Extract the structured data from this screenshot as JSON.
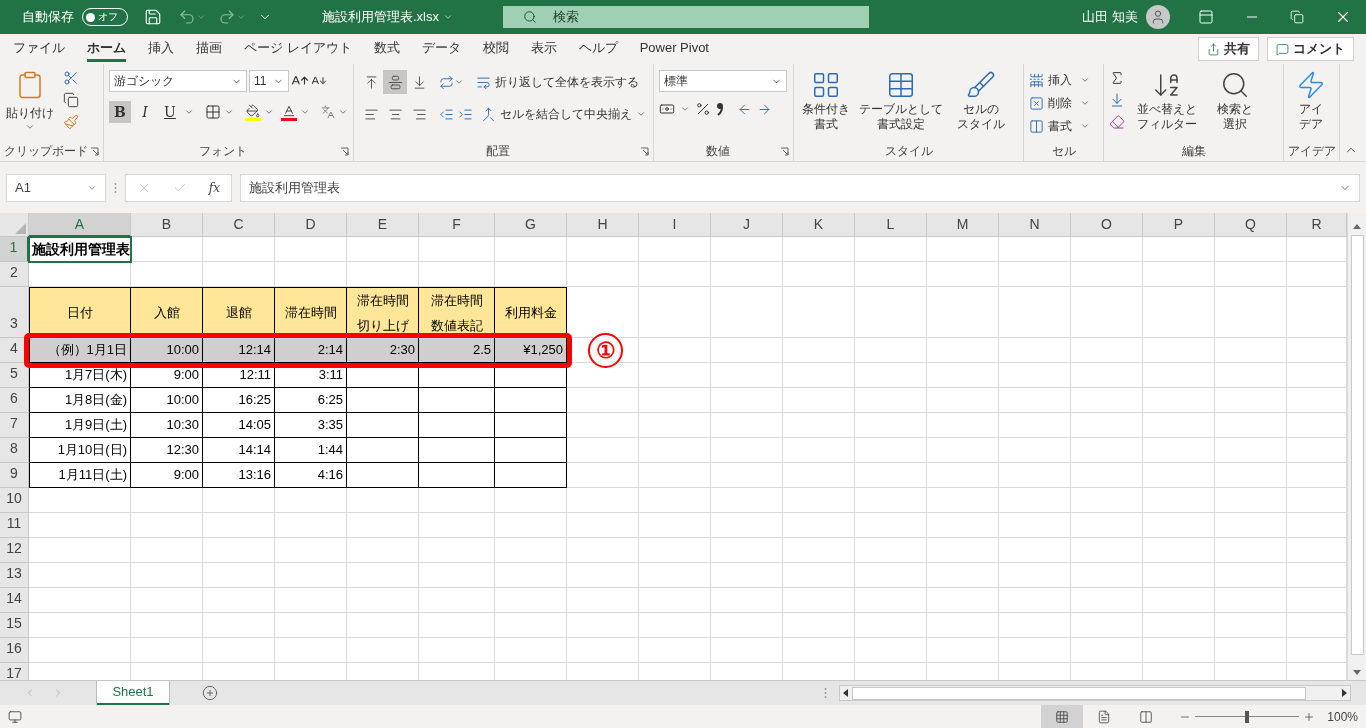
{
  "title_bar": {
    "autosave_label": "自動保存",
    "autosave": {
      "on": false,
      "label": "オフ"
    },
    "filename": "施設利用管理表.xlsx",
    "search_placeholder": "検索",
    "user_name": "山田 知美"
  },
  "menu_tabs": [
    {
      "label": "ファイル",
      "selected": false
    },
    {
      "label": "ホーム",
      "selected": true
    },
    {
      "label": "挿入",
      "selected": false
    },
    {
      "label": "描画",
      "selected": false
    },
    {
      "label": "ページ レイアウト",
      "selected": false
    },
    {
      "label": "数式",
      "selected": false
    },
    {
      "label": "データ",
      "selected": false
    },
    {
      "label": "校閲",
      "selected": false
    },
    {
      "label": "表示",
      "selected": false
    },
    {
      "label": "ヘルプ",
      "selected": false
    },
    {
      "label": "Power Pivot",
      "selected": false
    }
  ],
  "share_button": "共有",
  "comment_button": "コメント",
  "ribbon": {
    "clipboard": {
      "label": "クリップボード",
      "paste": "貼り付け"
    },
    "font": {
      "label": "フォント",
      "font_name": "游ゴシック",
      "font_size": "11",
      "styles": [
        {
          "kind": "bold",
          "label": "B",
          "selected": true
        },
        {
          "kind": "italic",
          "label": "I",
          "selected": false
        },
        {
          "kind": "underline",
          "label": "U",
          "selected": false
        }
      ]
    },
    "alignment": {
      "label": "配置",
      "wrap_text": "折り返して全体を表示する",
      "merge_center": "セルを結合して中央揃え",
      "vertical": [
        {
          "kind": "top",
          "selected": false
        },
        {
          "kind": "middle",
          "selected": true
        },
        {
          "kind": "bottom",
          "selected": false
        }
      ]
    },
    "number": {
      "label": "数値",
      "format": "標準"
    },
    "styles": {
      "label": "スタイル",
      "buttons": [
        {
          "kind": "conditional",
          "lines": [
            "条件付き",
            "書式"
          ]
        },
        {
          "kind": "table",
          "lines": [
            "テーブルとして",
            "書式設定"
          ]
        },
        {
          "kind": "cell",
          "lines": [
            "セルの",
            "スタイル"
          ]
        }
      ]
    },
    "cells": {
      "label": "セル",
      "buttons": [
        {
          "kind": "insert",
          "label": "挿入"
        },
        {
          "kind": "delete",
          "label": "削除"
        },
        {
          "kind": "format",
          "label": "書式"
        }
      ]
    },
    "editing": {
      "label": "編集",
      "buttons": [
        {
          "kind": "sort",
          "lines": [
            "並べ替えと",
            "フィルター"
          ]
        },
        {
          "kind": "find",
          "lines": [
            "検索と",
            "選択"
          ]
        }
      ]
    },
    "ideas": {
      "label": "アイデア",
      "lines": [
        "アイ",
        "デア"
      ]
    }
  },
  "formula_bar": {
    "name_box": "A1",
    "function_label": "fx",
    "value": "施設利用管理表"
  },
  "columns": [
    {
      "label": "A",
      "selected": true
    },
    {
      "label": "B",
      "selected": false
    },
    {
      "label": "C",
      "selected": false
    },
    {
      "label": "D",
      "selected": false
    },
    {
      "label": "E",
      "selected": false
    },
    {
      "label": "F",
      "selected": false
    },
    {
      "label": "G",
      "selected": false
    },
    {
      "label": "H",
      "selected": false
    },
    {
      "label": "I",
      "selected": false
    },
    {
      "label": "J",
      "selected": false
    },
    {
      "label": "K",
      "selected": false
    },
    {
      "label": "L",
      "selected": false
    },
    {
      "label": "M",
      "selected": false
    },
    {
      "label": "N",
      "selected": false
    },
    {
      "label": "O",
      "selected": false
    },
    {
      "label": "P",
      "selected": false
    },
    {
      "label": "Q",
      "selected": false
    },
    {
      "label": "R",
      "selected": false
    }
  ],
  "rows": [
    {
      "label": "1",
      "selected": true,
      "cells": [
        {
          "kind": "title",
          "text": "施設利用管理表"
        }
      ]
    },
    {
      "label": "2",
      "selected": false
    },
    {
      "label": "3",
      "selected": false,
      "cells": [
        {
          "kind": "header",
          "lines": [
            "日付"
          ]
        },
        {
          "kind": "header",
          "lines": [
            "入館"
          ]
        },
        {
          "kind": "header",
          "lines": [
            "退館"
          ]
        },
        {
          "kind": "header",
          "lines": [
            "滞在時間"
          ]
        },
        {
          "kind": "header",
          "lines": [
            "滞在時間",
            "切り上げ"
          ]
        },
        {
          "kind": "header",
          "lines": [
            "滞在時間",
            "数値表記"
          ]
        },
        {
          "kind": "header",
          "lines": [
            "利用料金"
          ]
        }
      ]
    },
    {
      "label": "4",
      "selected": false,
      "highlighted": true,
      "callout": "①",
      "cells": [
        {
          "kind": "data",
          "text": "（例）1月1日"
        },
        {
          "kind": "data",
          "text": "10:00"
        },
        {
          "kind": "data",
          "text": "12:14"
        },
        {
          "kind": "data",
          "text": "2:14"
        },
        {
          "kind": "data",
          "text": "2:30"
        },
        {
          "kind": "data",
          "text": "2.5"
        },
        {
          "kind": "data",
          "text": "¥1,250"
        }
      ]
    },
    {
      "label": "5",
      "selected": false,
      "highlighted": false,
      "cells": [
        {
          "kind": "data",
          "text": "1月7日(木)"
        },
        {
          "kind": "data",
          "text": "9:00"
        },
        {
          "kind": "data",
          "text": "12:11"
        },
        {
          "kind": "data",
          "text": "3:11"
        },
        {
          "kind": "data"
        },
        {
          "kind": "data"
        },
        {
          "kind": "data"
        }
      ]
    },
    {
      "label": "6",
      "selected": false,
      "highlighted": false,
      "cells": [
        {
          "kind": "data",
          "text": "1月8日(金)"
        },
        {
          "kind": "data",
          "text": "10:00"
        },
        {
          "kind": "data",
          "text": "16:25"
        },
        {
          "kind": "data",
          "text": "6:25"
        },
        {
          "kind": "data"
        },
        {
          "kind": "data"
        },
        {
          "kind": "data"
        }
      ]
    },
    {
      "label": "7",
      "selected": false,
      "highlighted": false,
      "cells": [
        {
          "kind": "data",
          "text": "1月9日(土)"
        },
        {
          "kind": "data",
          "text": "10:30"
        },
        {
          "kind": "data",
          "text": "14:05"
        },
        {
          "kind": "data",
          "text": "3:35"
        },
        {
          "kind": "data"
        },
        {
          "kind": "data"
        },
        {
          "kind": "data"
        }
      ]
    },
    {
      "label": "8",
      "selected": false,
      "highlighted": false,
      "cells": [
        {
          "kind": "data",
          "text": "1月10日(日)"
        },
        {
          "kind": "data",
          "text": "12:30"
        },
        {
          "kind": "data",
          "text": "14:14"
        },
        {
          "kind": "data",
          "text": "1:44"
        },
        {
          "kind": "data"
        },
        {
          "kind": "data"
        },
        {
          "kind": "data"
        }
      ]
    },
    {
      "label": "9",
      "selected": false,
      "highlighted": false,
      "cells": [
        {
          "kind": "data",
          "text": "1月11日(土)"
        },
        {
          "kind": "data",
          "text": "9:00"
        },
        {
          "kind": "data",
          "text": "13:16"
        },
        {
          "kind": "data",
          "text": "4:16"
        },
        {
          "kind": "data"
        },
        {
          "kind": "data"
        },
        {
          "kind": "data"
        }
      ]
    },
    {
      "label": "10",
      "selected": false
    },
    {
      "label": "11",
      "selected": false
    },
    {
      "label": "12",
      "selected": false
    },
    {
      "label": "13",
      "selected": false
    },
    {
      "label": "14",
      "selected": false
    },
    {
      "label": "15",
      "selected": false
    },
    {
      "label": "16",
      "selected": false
    },
    {
      "label": "17",
      "selected": false
    }
  ],
  "sheet_tabs": [
    {
      "label": "Sheet1",
      "selected": true
    }
  ],
  "status_bar": {
    "view_buttons": [
      {
        "kind": "normal",
        "selected": true
      },
      {
        "kind": "page_layout",
        "selected": false
      },
      {
        "kind": "page_break",
        "selected": false
      }
    ],
    "zoom": {
      "level": 0.5
    },
    "zoom_label": "100%"
  }
}
